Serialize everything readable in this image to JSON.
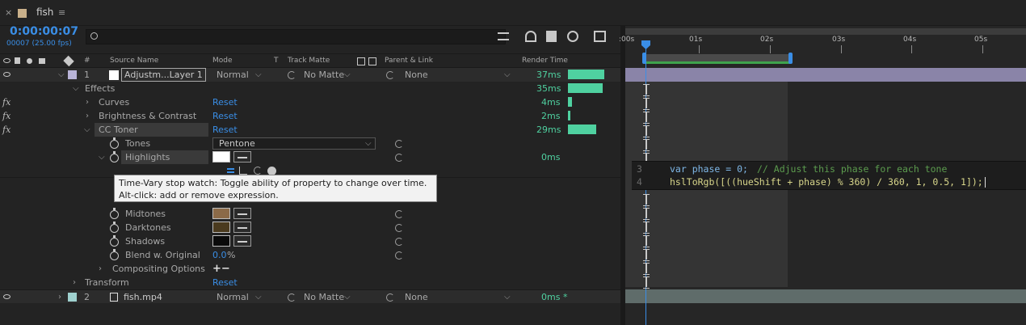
{
  "tab": {
    "close": "×",
    "name": "fish",
    "menu": "≡"
  },
  "timecode": {
    "value": "0:00:00:07",
    "frames": "00007 (25.00 fps)"
  },
  "search": {
    "placeholder": ""
  },
  "columns": {
    "num": "#",
    "source_name": "Source Name",
    "mode": "Mode",
    "t": "T",
    "track_matte": "Track Matte",
    "parent_link": "Parent & Link",
    "render_time": "Render Time"
  },
  "ruler": {
    "labels": [
      ":00s",
      "01s",
      "02s",
      "03s",
      "04s",
      "05s"
    ]
  },
  "layer1": {
    "num": "1",
    "name": "Adjustm...Layer 1",
    "mode": "Normal",
    "matte": "No Matte",
    "parent": "None",
    "render": "37ms",
    "render_fill": 1.0
  },
  "effects": {
    "label": "Effects",
    "render": "35ms",
    "render_fill": 0.95,
    "items": [
      {
        "name": "Curves",
        "reset": "Reset",
        "render": "4ms",
        "fx": "fx",
        "render_fill": 0.1
      },
      {
        "name": "Brightness & Contrast",
        "reset": "Reset",
        "render": "2ms",
        "fx": "fx",
        "render_fill": 0.05
      },
      {
        "name": "CC Toner",
        "reset": "Reset",
        "render": "29ms",
        "fx": "fx",
        "render_fill": 0.78
      }
    ]
  },
  "toner": {
    "tones_label": "Tones",
    "tones_value": "Pentone",
    "highlights_label": "Highlights",
    "highlights_render": "0ms",
    "midtones_label": "Midtones",
    "darktones_label": "Darktones",
    "shadows_label": "Shadows",
    "blend_label": "Blend w. Original",
    "blend_value": "0.0",
    "blend_unit": "%",
    "compositing_label": "Compositing Options",
    "plusminus": "+−",
    "colors": {
      "highlights": "#ffffff",
      "midtones": "#8b6a48",
      "darktones": "#4a3a1e",
      "shadows": "#0a0a0a"
    }
  },
  "transform": {
    "label": "Transform",
    "reset": "Reset"
  },
  "tooltip": {
    "text": "Time-Vary stop watch: Toggle ability of property to change over time. Alt-click: add or remove expression."
  },
  "layer2": {
    "num": "2",
    "name": "fish.mp4",
    "mode": "Normal",
    "matte": "No Matte",
    "parent": "None",
    "render": "0ms *"
  },
  "expression": {
    "line3_num": "3",
    "line3_code": "var phase = 0;",
    "line3_comment": "// Adjust this phase for each tone",
    "line4_num": "4",
    "line4_code": "hslToRgb([((hueShift + phase) % 360) / 360, 1, 0.5, 1]);"
  },
  "colors": {
    "accent": "#3a8ee6",
    "render_bar": "#4fd1a0",
    "layer1_bar": "#8a84a8",
    "layer2_bar": "#5f6c6a"
  }
}
